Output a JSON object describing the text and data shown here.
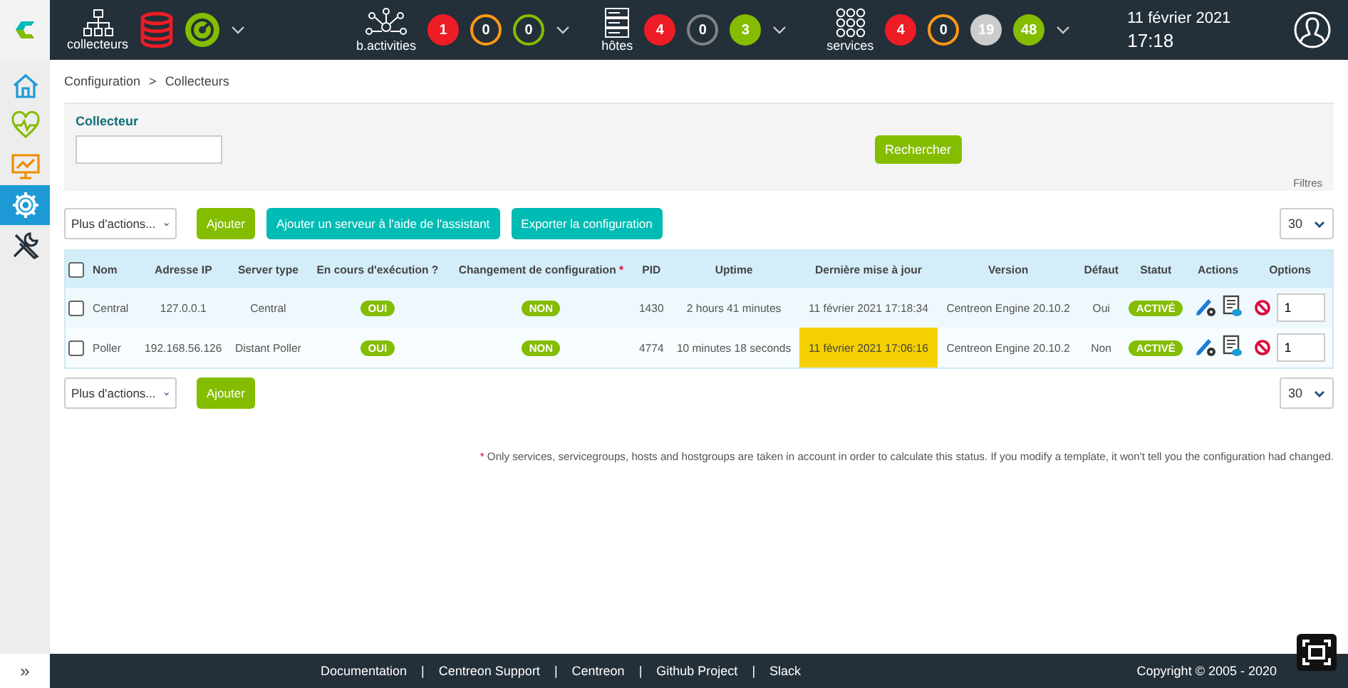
{
  "top_bar": {
    "pollers": {
      "label": "collecteurs",
      "indicators": [
        {
          "kind": "database",
          "color": "#ee1c25"
        },
        {
          "kind": "gauge",
          "color": "#84bd00"
        }
      ]
    },
    "groups": [
      {
        "kind": "activities",
        "label": "b.activities",
        "counters": [
          {
            "value": "1",
            "color": "#ee1c25",
            "filled": true
          },
          {
            "value": "0",
            "color": "#ff9913",
            "filled": false
          },
          {
            "value": "0",
            "color": "#84bd00",
            "filled": false
          }
        ]
      },
      {
        "kind": "hosts",
        "label": "hôtes",
        "counters": [
          {
            "value": "4",
            "color": "#ee1c25",
            "filled": true
          },
          {
            "value": "0",
            "color": "#818285",
            "filled": false
          },
          {
            "value": "3",
            "color": "#84bd00",
            "filled": true
          }
        ]
      },
      {
        "kind": "services",
        "label": "services",
        "counters": [
          {
            "value": "4",
            "color": "#ee1c25",
            "filled": true
          },
          {
            "value": "0",
            "color": "#ff9913",
            "filled": false
          },
          {
            "value": "19",
            "color": "#cccccc",
            "filled": true
          },
          {
            "value": "48",
            "color": "#84bd00",
            "filled": true
          }
        ]
      }
    ],
    "date": "11 février 2021",
    "time": "17:18"
  },
  "sidebar": {
    "items": [
      {
        "kind": "home",
        "selected": false
      },
      {
        "kind": "monitoring",
        "selected": false
      },
      {
        "kind": "reporting",
        "selected": false
      },
      {
        "kind": "configuration",
        "selected": true
      },
      {
        "kind": "administration",
        "selected": false
      }
    ],
    "toggle": "»"
  },
  "breadcrumb": {
    "items": [
      "Configuration",
      "Collecteurs"
    ],
    "separator": ">"
  },
  "filter": {
    "label": "Collecteur",
    "search_button": "Rechercher",
    "filters_label": "Filtres"
  },
  "toolbar": {
    "actions_select": "Plus d'actions...",
    "buttons": [
      {
        "label": "Ajouter",
        "kind": "primary"
      },
      {
        "label": "Ajouter un serveur à l'aide de l'assistant",
        "kind": "secondary"
      },
      {
        "label": "Exporter la configuration",
        "kind": "secondary"
      }
    ],
    "page_size": "30"
  },
  "table": {
    "select_all": {
      "checked": false
    },
    "columns": [
      {
        "label": "Nom"
      },
      {
        "label": "Adresse IP"
      },
      {
        "label": "Server type"
      },
      {
        "label": "En cours d'exécution ?"
      },
      {
        "label": "Changement de configuration",
        "marker": "*"
      },
      {
        "label": "PID"
      },
      {
        "label": "Uptime"
      },
      {
        "label": "Dernière mise à jour"
      },
      {
        "label": "Version"
      },
      {
        "label": "Défaut"
      },
      {
        "label": "Statut"
      },
      {
        "label": "Actions"
      },
      {
        "label": "Options"
      }
    ],
    "rows": [
      {
        "checked": false,
        "name": "Central",
        "ip": "127.0.0.1",
        "type": "Central",
        "running": "OUI",
        "config_changed": "NON",
        "pid": "1430",
        "uptime": "2 hours 41 minutes",
        "last_update": "11 février 2021 17:18:34",
        "stale": false,
        "version": "Centreon Engine 20.10.2",
        "default": "Oui",
        "status": "ACTIVÉ",
        "option": "1"
      },
      {
        "checked": false,
        "name": "Poller",
        "ip": "192.168.56.126",
        "type": "Distant Poller",
        "running": "OUI",
        "config_changed": "NON",
        "pid": "4774",
        "uptime": "10 minutes 18 seconds",
        "last_update": "11 février 2021 17:06:16",
        "stale": true,
        "version": "Centreon Engine 20.10.2",
        "default": "Non",
        "status": "ACTIVÉ",
        "option": "1"
      }
    ]
  },
  "bottom_toolbar": {
    "actions_select": "Plus d'actions...",
    "button": "Ajouter",
    "page_size": "30"
  },
  "note": {
    "marker": "*",
    "text": "Only services, servicegroups, hosts and hostgroups are taken in account in order to calculate this status. If you modify a template, it won't tell you the configuration had changed."
  },
  "footer": {
    "links": [
      "Documentation",
      "Centreon Support",
      "Centreon",
      "Github Project",
      "Slack"
    ],
    "separator": "|",
    "copyright": "Copyright © 2005 - 2020"
  }
}
